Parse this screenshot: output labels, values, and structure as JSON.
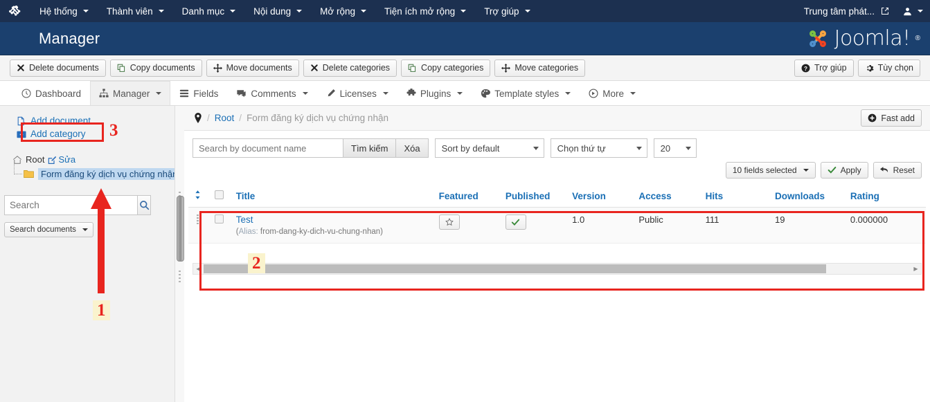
{
  "topbar": {
    "logo_icon": "joomla-icon",
    "menu": [
      {
        "label": "Hệ thống",
        "caret": true
      },
      {
        "label": "Thành viên",
        "caret": true
      },
      {
        "label": "Danh mục",
        "caret": true
      },
      {
        "label": "Nội dung",
        "caret": true
      },
      {
        "label": "Mở rộng",
        "caret": true
      },
      {
        "label": "Tiện ích mở rộng",
        "caret": true
      },
      {
        "label": "Trợ giúp",
        "caret": true
      }
    ],
    "site_link": "Trung tâm phát...",
    "site_link_icon": "external-link-icon",
    "user_icon": "user-icon"
  },
  "subhead": {
    "title": "Manager",
    "logo_word": "Joomla!",
    "logo_reg": "®"
  },
  "toolbar": {
    "buttons": [
      {
        "label": "Delete documents",
        "icon": "x-icon"
      },
      {
        "label": "Copy documents",
        "icon": "copy-icon"
      },
      {
        "label": "Move documents",
        "icon": "move-icon"
      },
      {
        "label": "Delete categories",
        "icon": "x-icon"
      },
      {
        "label": "Copy categories",
        "icon": "copy-icon"
      },
      {
        "label": "Move categories",
        "icon": "move-icon"
      }
    ],
    "right_buttons": [
      {
        "label": "Trợ giúp",
        "icon": "help-icon"
      },
      {
        "label": "Tùy chọn",
        "icon": "gear-icon"
      }
    ]
  },
  "navtabs": [
    {
      "label": "Dashboard",
      "icon": "dashboard-icon",
      "caret": false,
      "active": false
    },
    {
      "label": "Manager",
      "icon": "sitemap-icon",
      "caret": true,
      "active": true
    },
    {
      "label": "Fields",
      "icon": "list-icon",
      "caret": false,
      "active": false
    },
    {
      "label": "Comments",
      "icon": "comment-icon",
      "caret": true,
      "active": false
    },
    {
      "label": "Licenses",
      "icon": "pencil-icon",
      "caret": true,
      "active": false
    },
    {
      "label": "Plugins",
      "icon": "puzzle-icon",
      "caret": true,
      "active": false
    },
    {
      "label": "Template styles",
      "icon": "palette-icon",
      "caret": true,
      "active": false
    },
    {
      "label": "More",
      "icon": "more-icon",
      "caret": true,
      "active": false
    }
  ],
  "sidebar": {
    "add_document": "Add document",
    "add_category": "Add category",
    "root_label": "Root",
    "root_edit": "Sửa",
    "child_label": "Form đăng ký dịch vụ chứng nhận",
    "search_placeholder": "Search",
    "search_value": "",
    "search_scope": "Search documents"
  },
  "breadcrumb": {
    "pin_icon": "map-pin-icon",
    "root": "Root",
    "current": "Form đăng ký dịch vụ chứng nhận",
    "fast_add": "Fast add"
  },
  "filters": {
    "search_placeholder": "Search by document name",
    "search_value": "",
    "search_button": "Tìm kiếm",
    "clear_button": "Xóa",
    "sort_select": "Sort by default",
    "order_select": "Chọn thứ tự",
    "limit_select": "20",
    "fields_selected": "10 fields selected",
    "apply_button": "Apply",
    "reset_button": "Reset"
  },
  "table": {
    "headers": [
      "",
      "",
      "Title",
      "Featured",
      "Published",
      "Version",
      "Access",
      "Hits",
      "Downloads",
      "Rating"
    ],
    "rows": [
      {
        "title": "Test",
        "alias_key": "Alias:",
        "alias_value": "from-dang-ky-dich-vu-chung-nhan",
        "featured": "off",
        "published": "on",
        "version": "1.0",
        "access": "Public",
        "hits": "111",
        "downloads": "19",
        "rating": "0.000000"
      }
    ]
  },
  "annotations": [
    {
      "num": "1"
    },
    {
      "num": "2"
    },
    {
      "num": "3"
    }
  ],
  "colors": {
    "topbar_bg": "#1c3050",
    "subhead_bg": "#1b406e",
    "link": "#1a6fb5",
    "annotation_red": "#e8251f",
    "highlight_yellow": "#faf3cd"
  }
}
